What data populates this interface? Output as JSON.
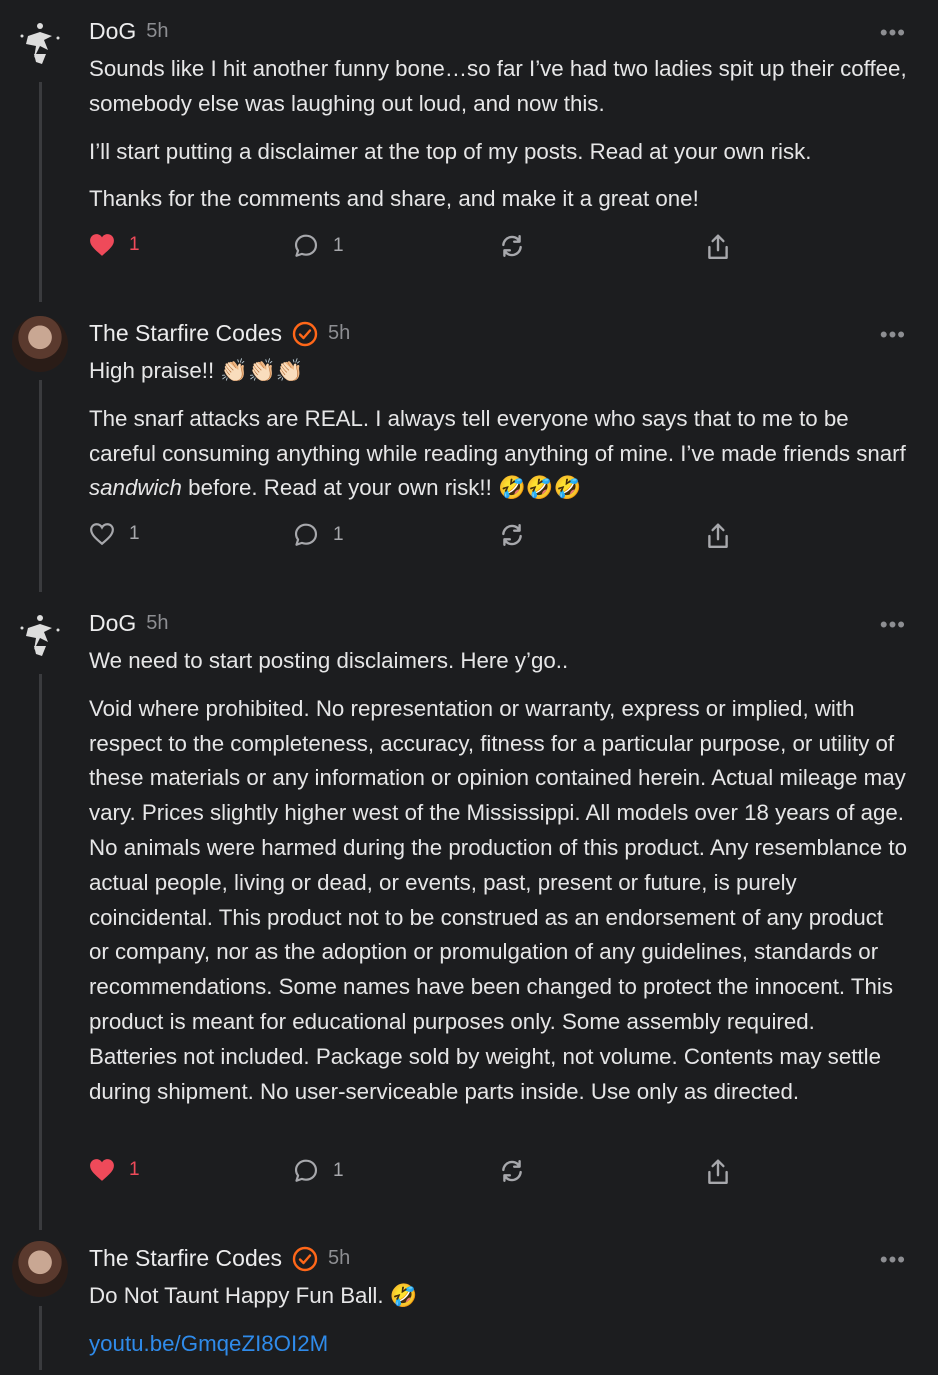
{
  "posts": [
    {
      "author": "DoG",
      "time": "5h",
      "verified": false,
      "paragraphs": [
        "Sounds like I hit another funny bone…so far I’ve had two ladies spit up their coffee, somebody else was laughing out loud, and now this.",
        "I’ll start putting a disclaimer at the top of my posts. Read at your own risk.",
        "Thanks for the comments and share, and make it a great one!"
      ],
      "likes": "1",
      "liked": true,
      "comments": "1"
    },
    {
      "author": "The Starfire Codes",
      "time": "5h",
      "verified": true,
      "line1": "High praise!! 👏🏻👏🏻👏🏻",
      "p2_before": "The snarf attacks are REAL. I always tell everyone who says that to me to be careful consuming anything while reading anything of mine. I’ve made friends snarf ",
      "p2_italic": "sandwich",
      "p2_after": " before. Read at your own risk!! 🤣🤣🤣",
      "likes": "1",
      "liked": false,
      "comments": "1"
    },
    {
      "author": "DoG",
      "time": "5h",
      "verified": false,
      "paragraphs": [
        "We need to start posting disclaimers. Here y’go..",
        "Void where prohibited. No representation or warranty, express or implied, with respect to the completeness, accuracy, fitness for a particular purpose, or utility of these materials or any information or opinion contained herein. Actual mileage may vary. Prices slightly higher west of the Mississippi. All models over 18 years of age. No animals were harmed during the production of this product. Any resemblance to actual people, living or dead, or events, past, present or future, is purely coincidental. This product not to be construed as an endorsement of any product or company, nor as the adoption or promulgation of any guidelines, standards or recommendations. Some names have been changed to protect the innocent. This product is meant for educational purposes only. Some assembly required. Batteries not included. Package sold by weight, not volume. Contents may settle during shipment. No user-serviceable parts inside. Use only as directed."
      ],
      "likes": "1",
      "liked": true,
      "comments": "1"
    },
    {
      "author": "The Starfire Codes",
      "time": "5h",
      "verified": true,
      "paragraphs": [
        "Do Not Taunt Happy Fun Ball. 🤣"
      ],
      "link": "youtu.be/GmqeZI8OI2M"
    }
  ],
  "more_label": "•••",
  "colors": {
    "accent": "#ef4a5a",
    "verified": "#ff6719",
    "link": "#2f8bea",
    "background": "#1c1d1f"
  }
}
